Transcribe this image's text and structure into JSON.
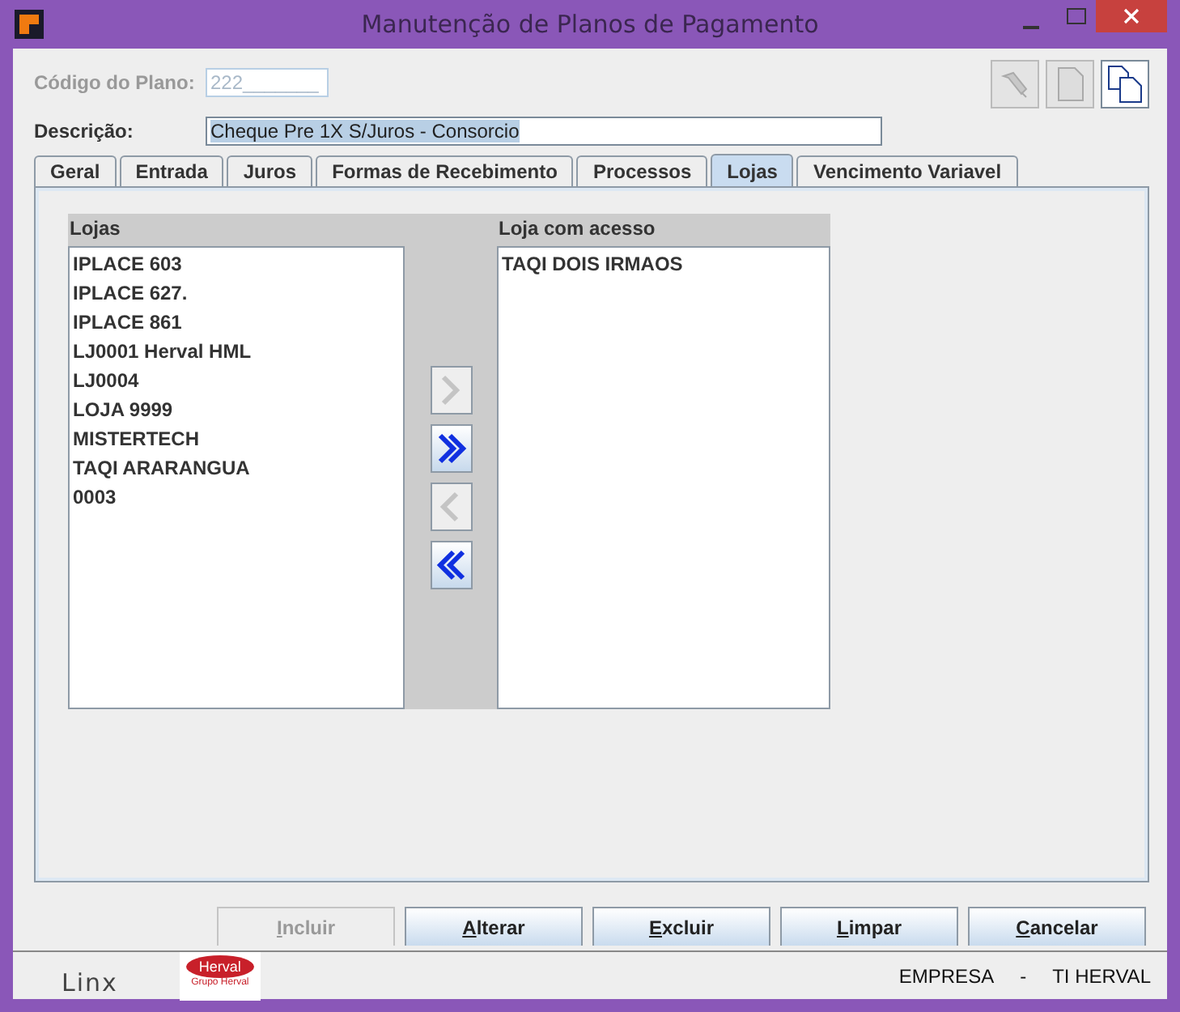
{
  "window": {
    "title": "Manutenção de Planos de Pagamento"
  },
  "toolbar": [
    {
      "kind": "flashlight",
      "disabled": true
    },
    {
      "kind": "new_page",
      "disabled": true
    },
    {
      "kind": "copy_pages",
      "disabled": false
    }
  ],
  "code_field": {
    "label": "Código do Plano:",
    "value": "222_______",
    "disabled": true
  },
  "description_field": {
    "label": "Descrição:",
    "value": "Cheque Pre 1X S/Juros - Consorcio",
    "selected": true
  },
  "tabs": [
    {
      "label": "Geral",
      "selected": false
    },
    {
      "label": "Entrada",
      "selected": false
    },
    {
      "label": "Juros",
      "selected": false
    },
    {
      "label": "Formas de Recebimento",
      "selected": false
    },
    {
      "label": "Processos",
      "selected": false
    },
    {
      "label": "Lojas",
      "selected": true
    },
    {
      "label": "Vencimento Variavel",
      "selected": false
    }
  ],
  "lojas": {
    "available_title": "Lojas",
    "available": [
      "IPLACE 603",
      "IPLACE 627.",
      "IPLACE 861",
      "LJ0001 Herval HML",
      "LJ0004",
      "LOJA 9999",
      "MISTERTECH",
      "TAQI ARARANGUA",
      "0003"
    ],
    "access_title": "Loja com acesso",
    "access": [
      "TAQI DOIS IRMAOS"
    ],
    "transfer_buttons": [
      {
        "kind": "add",
        "disabled": true
      },
      {
        "kind": "add_all",
        "disabled": false
      },
      {
        "kind": "remove",
        "disabled": true
      },
      {
        "kind": "remove_all",
        "disabled": false
      }
    ]
  },
  "actions": [
    {
      "label": "Incluir",
      "disabled": true
    },
    {
      "label": "Alterar",
      "disabled": false
    },
    {
      "label": "Excluir",
      "disabled": false
    },
    {
      "label": "Limpar",
      "disabled": false
    },
    {
      "label": "Cancelar",
      "disabled": false
    }
  ],
  "status_bar": {
    "linx_logo": "Linx",
    "herval_logo": "Herval",
    "herval_subtitle": "Grupo Herval",
    "texts": [
      "EMPRESA",
      "-",
      "TI HERVAL"
    ]
  }
}
